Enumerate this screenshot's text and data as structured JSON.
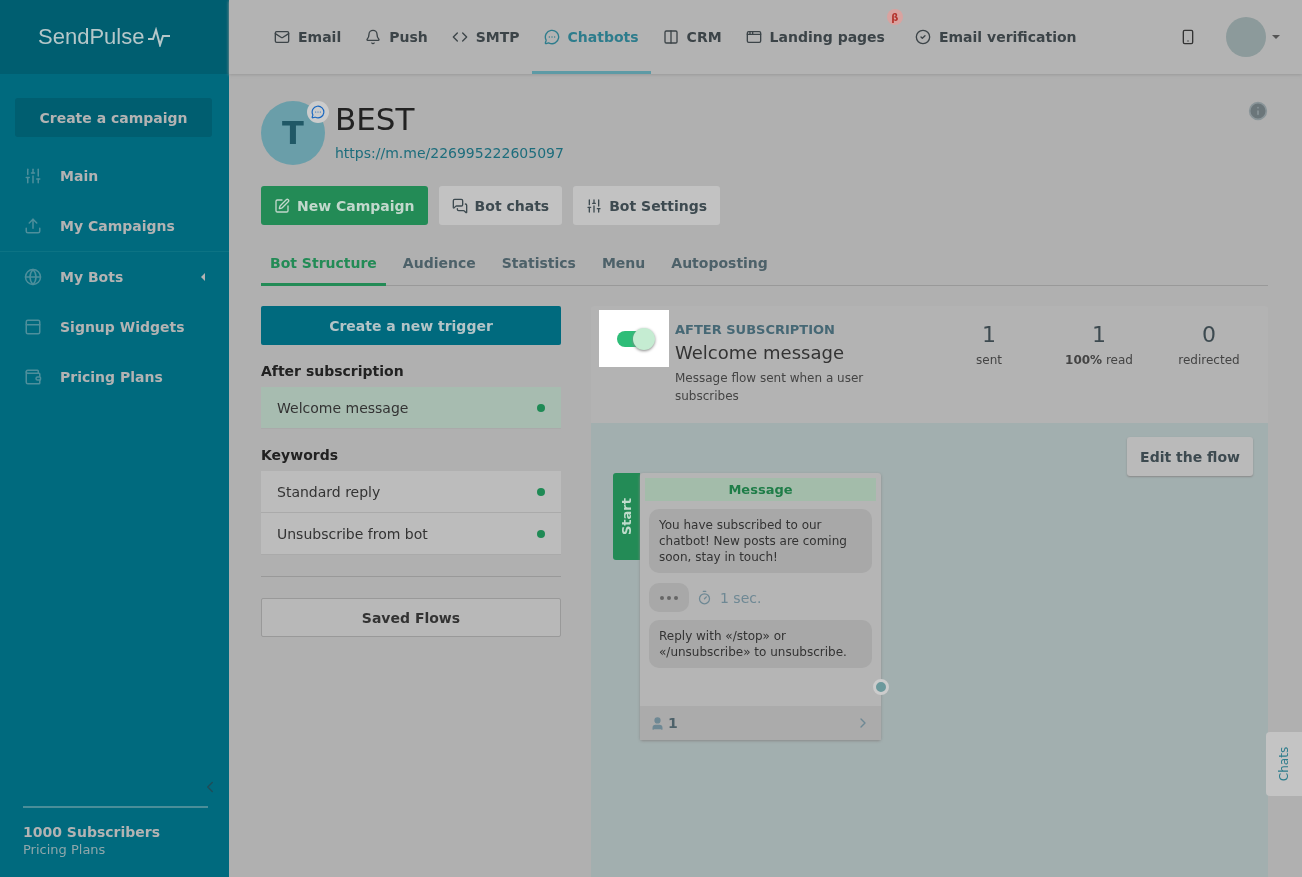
{
  "logo": {
    "text": "SendPulse"
  },
  "nav": [
    {
      "label": "Email",
      "selected": false
    },
    {
      "label": "Push",
      "selected": false
    },
    {
      "label": "SMTP",
      "selected": false
    },
    {
      "label": "Chatbots",
      "selected": true
    },
    {
      "label": "CRM",
      "selected": false
    },
    {
      "label": "Landing pages",
      "selected": false,
      "badge": "β"
    },
    {
      "label": "Email verification",
      "selected": false
    }
  ],
  "sidebar": {
    "create_button": "Create a campaign",
    "items": [
      {
        "label": "Main",
        "expandable": false
      },
      {
        "label": "My Campaigns",
        "expandable": false
      },
      {
        "label": "My Bots",
        "expandable": true
      },
      {
        "label": "Signup Widgets",
        "expandable": false
      },
      {
        "label": "Pricing Plans",
        "expandable": false
      }
    ],
    "footer": {
      "title": "1000 Subscribers",
      "subtitle": "Pricing Plans"
    }
  },
  "bot": {
    "avatar_letter": "T",
    "name": "BEST",
    "link": "https://m.me/226995222605097",
    "actions": [
      {
        "label": "New Campaign",
        "kind": "primary"
      },
      {
        "label": "Bot chats",
        "kind": "secondary"
      },
      {
        "label": "Bot Settings",
        "kind": "secondary"
      }
    ],
    "tabs": [
      {
        "label": "Bot Structure",
        "selected": true
      },
      {
        "label": "Audience",
        "selected": false
      },
      {
        "label": "Statistics",
        "selected": false
      },
      {
        "label": "Menu",
        "selected": false
      },
      {
        "label": "Autoposting",
        "selected": false
      }
    ]
  },
  "triggers": {
    "create_button": "Create a new trigger",
    "groups": [
      {
        "title": "After subscription",
        "items": [
          {
            "label": "Welcome message",
            "selected": true,
            "color": "#1f8a55"
          }
        ]
      },
      {
        "title": "Keywords",
        "items": [
          {
            "label": "Standard reply",
            "selected": false,
            "color": "#1f8a55"
          },
          {
            "label": "Unsubscribe from bot",
            "selected": false,
            "color": "#1f8a55"
          }
        ]
      }
    ],
    "saved_flows_button": "Saved Flows"
  },
  "detail": {
    "enabled": true,
    "category": "AFTER SUBSCRIPTION",
    "title": "Welcome message",
    "description": "Message flow sent when a user subscribes",
    "stats": [
      {
        "value": "1",
        "label": "sent"
      },
      {
        "value": "1",
        "label": "**100%** read"
      },
      {
        "value": "0",
        "label": "redirected"
      }
    ]
  },
  "flow": {
    "edit_button": "Edit the flow",
    "start_label": "Start",
    "card_title": "Message",
    "messages": [
      {
        "kind": "text",
        "text": "You have subscribed to our chatbot! New posts are coming soon, stay in touch!"
      },
      {
        "kind": "delay",
        "text": "1 sec."
      },
      {
        "kind": "text",
        "text": "Reply with «/stop» or «/unsubscribe» to unsubscribe."
      }
    ],
    "subscriber_count": "1"
  },
  "chats_tab": "Chats"
}
